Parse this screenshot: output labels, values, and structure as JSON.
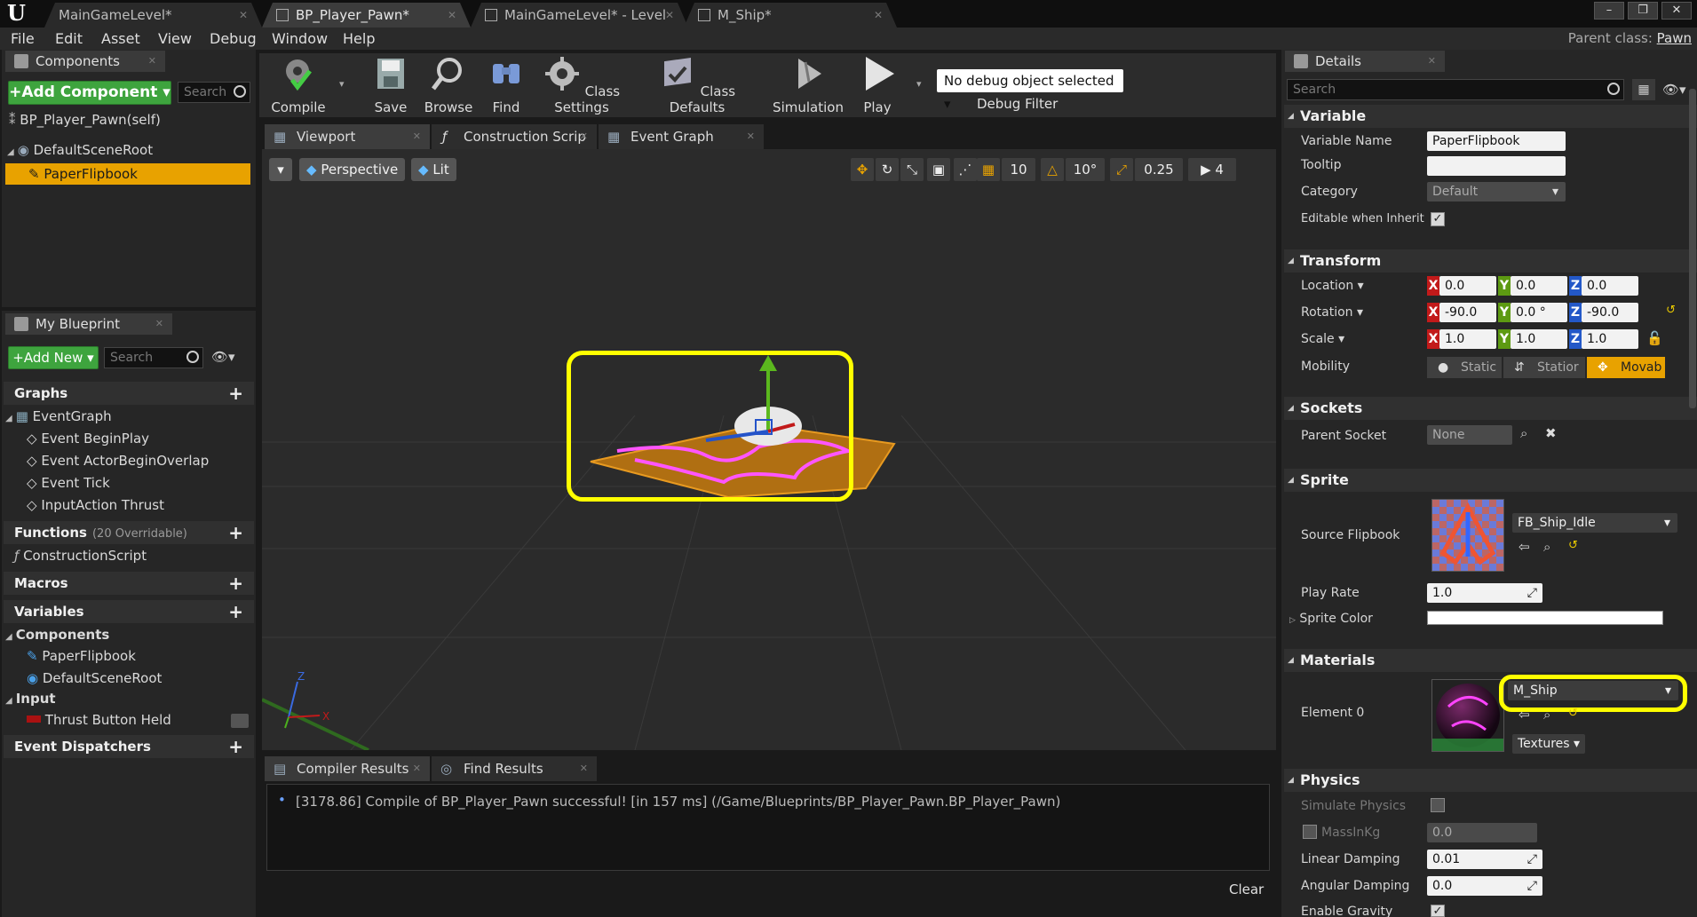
{
  "title_tabs": [
    "MainGameLevel*",
    "BP_Player_Pawn*",
    "MainGameLevel* - Level",
    "M_Ship*"
  ],
  "menu": [
    "File",
    "Edit",
    "Asset",
    "View",
    "Debug",
    "Window",
    "Help"
  ],
  "parent_class": {
    "label": "Parent class:",
    "value": "Pawn"
  },
  "components": {
    "tab": "Components",
    "add_button": "+Add Component",
    "search_placeholder": "Search",
    "self_label": "BP_Player_Pawn(self)",
    "items": [
      "DefaultSceneRoot",
      "PaperFlipbook"
    ]
  },
  "my_blueprint": {
    "tab": "My Blueprint",
    "add_button": "Add New",
    "search_placeholder": "Search",
    "sections": {
      "graphs": "Graphs",
      "functions": "Functions",
      "functions_sub": "(20 Overridable)",
      "macros": "Macros",
      "variables": "Variables",
      "event_dispatchers": "Event Dispatchers"
    },
    "event_graph": "EventGraph",
    "events": [
      "Event BeginPlay",
      "Event ActorBeginOverlap",
      "Event Tick",
      "InputAction Thrust"
    ],
    "construction_script": "ConstructionScript",
    "components_label": "Components",
    "component_vars": [
      "PaperFlipbook",
      "DefaultSceneRoot"
    ],
    "input_label": "Input",
    "input_vars": [
      "Thrust Button Held"
    ]
  },
  "toolbar": {
    "buttons": [
      "Compile",
      "Save",
      "Browse",
      "Find",
      "Class Settings",
      "Class Defaults",
      "Simulation",
      "Play"
    ],
    "debug_select": "No debug object selected",
    "debug_filter": "Debug Filter"
  },
  "editor_tabs": [
    "Viewport",
    "Construction Scrip",
    "Event Graph"
  ],
  "viewport": {
    "perspective": "Perspective",
    "lit": "Lit",
    "grid_snap": "10",
    "rot_snap": "10°",
    "scale_snap": "0.25",
    "cam_speed": "4"
  },
  "bottom": {
    "tabs": [
      "Compiler Results",
      "Find Results"
    ],
    "log": "[3178.86] Compile of BP_Player_Pawn successful! [in 157 ms] (/Game/Blueprints/BP_Player_Pawn.BP_Player_Pawn)",
    "clear": "Clear"
  },
  "details": {
    "tab": "Details",
    "search_placeholder": "Search",
    "variable": {
      "section": "Variable",
      "name_label": "Variable Name",
      "name_value": "PaperFlipbook",
      "tooltip_label": "Tooltip",
      "tooltip_value": "",
      "category_label": "Category",
      "category_value": "Default",
      "editable_label": "Editable when Inherit"
    },
    "transform": {
      "section": "Transform",
      "location_label": "Location",
      "location": [
        "0.0",
        "0.0",
        "0.0"
      ],
      "rotation_label": "Rotation",
      "rotation": [
        "-90.0",
        "0.0 °",
        "-90.0"
      ],
      "scale_label": "Scale",
      "scale": [
        "1.0",
        "1.0",
        "1.0"
      ],
      "mobility_label": "Mobility",
      "mobility_options": [
        "Static",
        "Statior",
        "Movab"
      ]
    },
    "sockets": {
      "section": "Sockets",
      "parent_label": "Parent Socket",
      "parent_value": "None"
    },
    "sprite": {
      "section": "Sprite",
      "source_label": "Source Flipbook",
      "source_value": "FB_Ship_Idle",
      "play_rate_label": "Play Rate",
      "play_rate_value": "1.0",
      "color_label": "Sprite Color"
    },
    "materials": {
      "section": "Materials",
      "element_label": "Element 0",
      "element_value": "M_Ship",
      "textures": "Textures"
    },
    "physics": {
      "section": "Physics",
      "simulate_label": "Simulate Physics",
      "mass_label": "MassInKg",
      "mass_value": "0.0",
      "linear_label": "Linear Damping",
      "linear_value": "0.01",
      "angular_label": "Angular Damping",
      "angular_value": "0.0",
      "gravity_label": "Enable Gravity"
    }
  },
  "colors": {
    "accent": "#e8a200",
    "highlight": "#ffff00",
    "add_green": "#3ea43e"
  }
}
